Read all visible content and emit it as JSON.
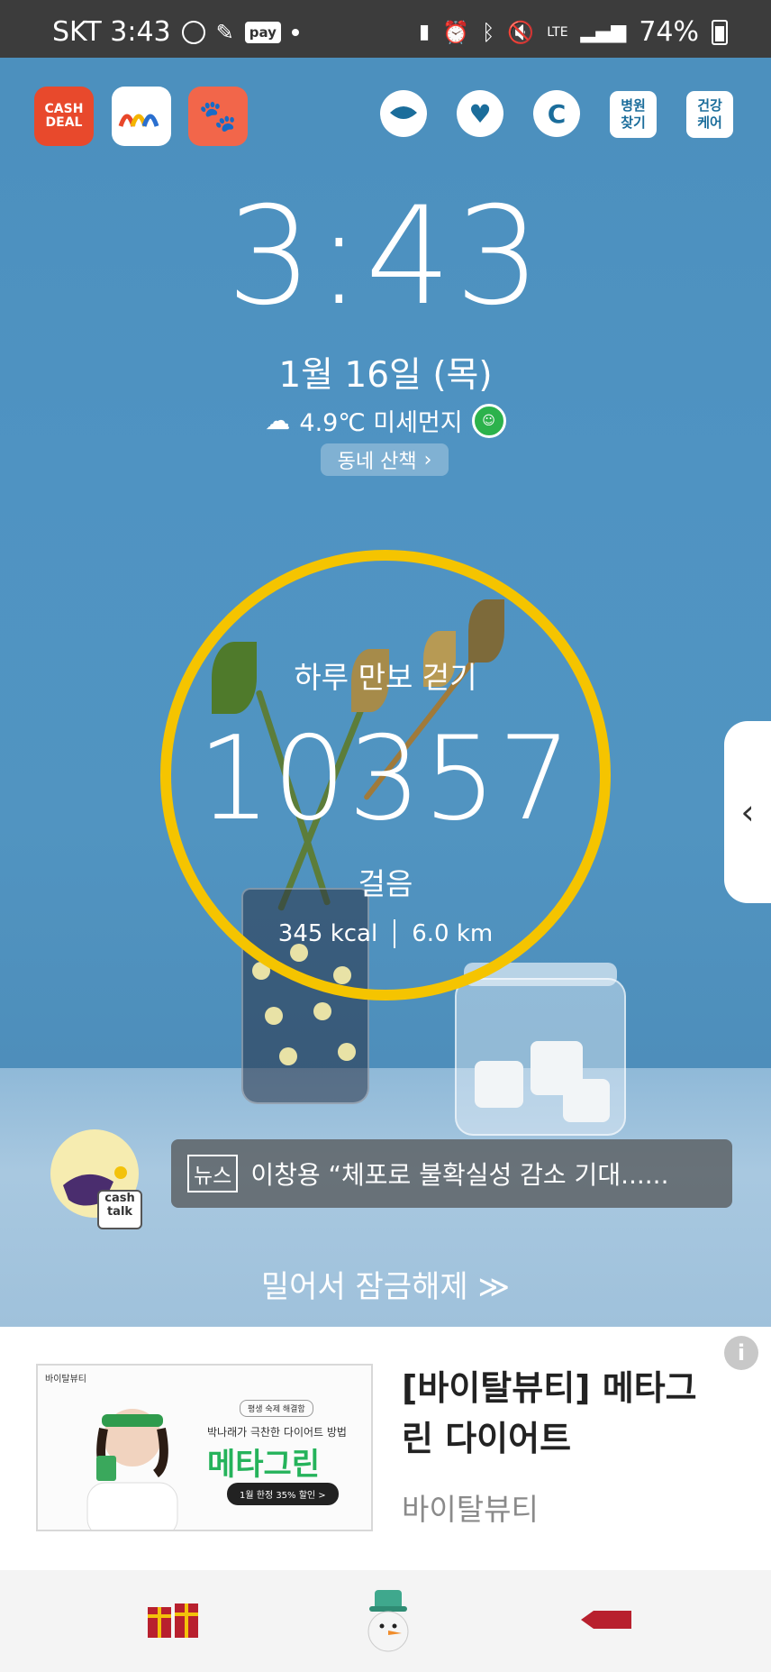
{
  "status_bar": {
    "carrier_time": "SKT 3:43",
    "pay_label": "pay",
    "network": "LTE",
    "battery": "74%"
  },
  "top_apps": {
    "cashdeal_label": "CASH DEAL",
    "hospital_label": "병원 찾기",
    "health_label": "건강 케어"
  },
  "lockscreen": {
    "time": "3:43",
    "date": "1월 16일 (목)",
    "weather": "4.9℃ 미세먼지",
    "walk_button": "동네 산책"
  },
  "pedometer": {
    "title": "하루 만보 걷기",
    "steps": "10357",
    "unit": "걸음",
    "kcal": "345 kcal",
    "distance": "6.0 km",
    "ring_color": "#f5c400"
  },
  "cashtalk": {
    "label": "cash talk"
  },
  "news": {
    "tag": "뉴스",
    "headline": "이창용 “체포로 불확실성 감소 기대......"
  },
  "unlock": {
    "text": "밀어서 잠금해제 ≫"
  },
  "ad": {
    "info": "i",
    "image_brand": "바이탈뷰티",
    "image_tagline": "평생 숙제 해결함",
    "image_line": "박나래가 극찬한 다이어트 방법",
    "image_product": "메타그린",
    "image_pill": "1월 한정 35% 할인 >",
    "title": "[바이탈뷰티] 메타그린 다이어트",
    "advertiser": "바이탈뷰티"
  }
}
